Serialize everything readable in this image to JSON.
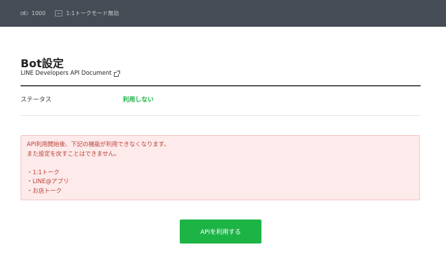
{
  "topbar": {
    "message_count": "1000",
    "chat_mode": "1:1トークモード無効"
  },
  "page": {
    "title": "Bot設定",
    "doc_link": "LINE Developers API Document"
  },
  "status": {
    "label": "ステータス",
    "value": "利用しない"
  },
  "warning": {
    "line1": "API利用開始後、下記の機能が利用できなくなります。",
    "line2": "また設定を戻すことはできません。",
    "items": [
      "・1:1トーク",
      "・LINE@アプリ",
      "・お店トーク"
    ]
  },
  "button": {
    "label": "APIを利用する"
  },
  "colors": {
    "topbar_bg": "#464c55",
    "accent_green": "#1db446",
    "warning_bg": "#fdeaea",
    "warning_text": "#b8423a"
  }
}
